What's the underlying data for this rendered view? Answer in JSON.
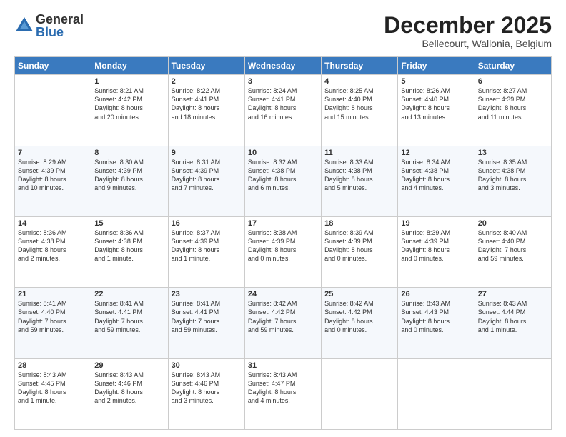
{
  "logo": {
    "general": "General",
    "blue": "Blue"
  },
  "title": "December 2025",
  "subtitle": "Bellecourt, Wallonia, Belgium",
  "days": [
    "Sunday",
    "Monday",
    "Tuesday",
    "Wednesday",
    "Thursday",
    "Friday",
    "Saturday"
  ],
  "weeks": [
    [
      {
        "day": "",
        "info": ""
      },
      {
        "day": "1",
        "info": "Sunrise: 8:21 AM\nSunset: 4:42 PM\nDaylight: 8 hours\nand 20 minutes."
      },
      {
        "day": "2",
        "info": "Sunrise: 8:22 AM\nSunset: 4:41 PM\nDaylight: 8 hours\nand 18 minutes."
      },
      {
        "day": "3",
        "info": "Sunrise: 8:24 AM\nSunset: 4:41 PM\nDaylight: 8 hours\nand 16 minutes."
      },
      {
        "day": "4",
        "info": "Sunrise: 8:25 AM\nSunset: 4:40 PM\nDaylight: 8 hours\nand 15 minutes."
      },
      {
        "day": "5",
        "info": "Sunrise: 8:26 AM\nSunset: 4:40 PM\nDaylight: 8 hours\nand 13 minutes."
      },
      {
        "day": "6",
        "info": "Sunrise: 8:27 AM\nSunset: 4:39 PM\nDaylight: 8 hours\nand 11 minutes."
      }
    ],
    [
      {
        "day": "7",
        "info": "Sunrise: 8:29 AM\nSunset: 4:39 PM\nDaylight: 8 hours\nand 10 minutes."
      },
      {
        "day": "8",
        "info": "Sunrise: 8:30 AM\nSunset: 4:39 PM\nDaylight: 8 hours\nand 9 minutes."
      },
      {
        "day": "9",
        "info": "Sunrise: 8:31 AM\nSunset: 4:39 PM\nDaylight: 8 hours\nand 7 minutes."
      },
      {
        "day": "10",
        "info": "Sunrise: 8:32 AM\nSunset: 4:38 PM\nDaylight: 8 hours\nand 6 minutes."
      },
      {
        "day": "11",
        "info": "Sunrise: 8:33 AM\nSunset: 4:38 PM\nDaylight: 8 hours\nand 5 minutes."
      },
      {
        "day": "12",
        "info": "Sunrise: 8:34 AM\nSunset: 4:38 PM\nDaylight: 8 hours\nand 4 minutes."
      },
      {
        "day": "13",
        "info": "Sunrise: 8:35 AM\nSunset: 4:38 PM\nDaylight: 8 hours\nand 3 minutes."
      }
    ],
    [
      {
        "day": "14",
        "info": "Sunrise: 8:36 AM\nSunset: 4:38 PM\nDaylight: 8 hours\nand 2 minutes."
      },
      {
        "day": "15",
        "info": "Sunrise: 8:36 AM\nSunset: 4:38 PM\nDaylight: 8 hours\nand 1 minute."
      },
      {
        "day": "16",
        "info": "Sunrise: 8:37 AM\nSunset: 4:39 PM\nDaylight: 8 hours\nand 1 minute."
      },
      {
        "day": "17",
        "info": "Sunrise: 8:38 AM\nSunset: 4:39 PM\nDaylight: 8 hours\nand 0 minutes."
      },
      {
        "day": "18",
        "info": "Sunrise: 8:39 AM\nSunset: 4:39 PM\nDaylight: 8 hours\nand 0 minutes."
      },
      {
        "day": "19",
        "info": "Sunrise: 8:39 AM\nSunset: 4:39 PM\nDaylight: 8 hours\nand 0 minutes."
      },
      {
        "day": "20",
        "info": "Sunrise: 8:40 AM\nSunset: 4:40 PM\nDaylight: 7 hours\nand 59 minutes."
      }
    ],
    [
      {
        "day": "21",
        "info": "Sunrise: 8:41 AM\nSunset: 4:40 PM\nDaylight: 7 hours\nand 59 minutes."
      },
      {
        "day": "22",
        "info": "Sunrise: 8:41 AM\nSunset: 4:41 PM\nDaylight: 7 hours\nand 59 minutes."
      },
      {
        "day": "23",
        "info": "Sunrise: 8:41 AM\nSunset: 4:41 PM\nDaylight: 7 hours\nand 59 minutes."
      },
      {
        "day": "24",
        "info": "Sunrise: 8:42 AM\nSunset: 4:42 PM\nDaylight: 7 hours\nand 59 minutes."
      },
      {
        "day": "25",
        "info": "Sunrise: 8:42 AM\nSunset: 4:42 PM\nDaylight: 8 hours\nand 0 minutes."
      },
      {
        "day": "26",
        "info": "Sunrise: 8:43 AM\nSunset: 4:43 PM\nDaylight: 8 hours\nand 0 minutes."
      },
      {
        "day": "27",
        "info": "Sunrise: 8:43 AM\nSunset: 4:44 PM\nDaylight: 8 hours\nand 1 minute."
      }
    ],
    [
      {
        "day": "28",
        "info": "Sunrise: 8:43 AM\nSunset: 4:45 PM\nDaylight: 8 hours\nand 1 minute."
      },
      {
        "day": "29",
        "info": "Sunrise: 8:43 AM\nSunset: 4:46 PM\nDaylight: 8 hours\nand 2 minutes."
      },
      {
        "day": "30",
        "info": "Sunrise: 8:43 AM\nSunset: 4:46 PM\nDaylight: 8 hours\nand 3 minutes."
      },
      {
        "day": "31",
        "info": "Sunrise: 8:43 AM\nSunset: 4:47 PM\nDaylight: 8 hours\nand 4 minutes."
      },
      {
        "day": "",
        "info": ""
      },
      {
        "day": "",
        "info": ""
      },
      {
        "day": "",
        "info": ""
      }
    ]
  ]
}
